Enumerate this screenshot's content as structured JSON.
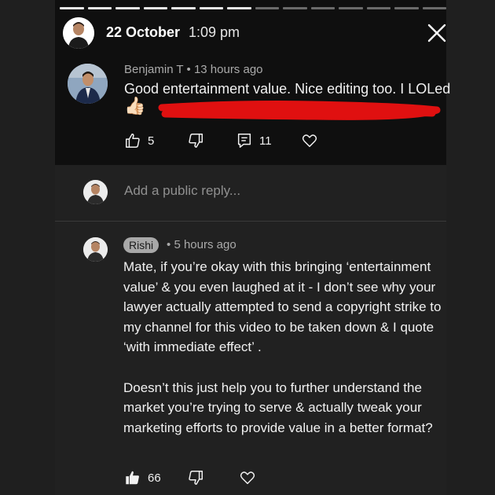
{
  "story": {
    "date": "22 October",
    "time": "1:09 pm",
    "progress": {
      "segments": 14,
      "completed": 7
    }
  },
  "comment": {
    "author": "Benjamin T",
    "separator": "•",
    "age": "13 hours ago",
    "text": "Good entertainment value. Nice editing too. I LOLed",
    "emoji": "👍🏻",
    "likes": "5",
    "replies": "11"
  },
  "reply_box": {
    "placeholder": "Add a public reply..."
  },
  "reply": {
    "author": "Rishi",
    "separator": "•",
    "age": "5 hours ago",
    "paragraph1": "Mate, if you’re okay with this bringing ‘entertainment value’ & you even laughed at it - I don’t see why your lawyer actually attempted to send a copyright strike to my channel for this video to be taken down & I quote ‘with immediate effect’ .",
    "paragraph2": "Doesn’t this just help you to further understand the market you’re trying to serve & actually tweak your marketing efforts to provide value in a better format?",
    "likes": "66"
  },
  "colors": {
    "background": "#0f0f0f",
    "redaction": "#e01010",
    "badge": "#a8a8a8"
  }
}
